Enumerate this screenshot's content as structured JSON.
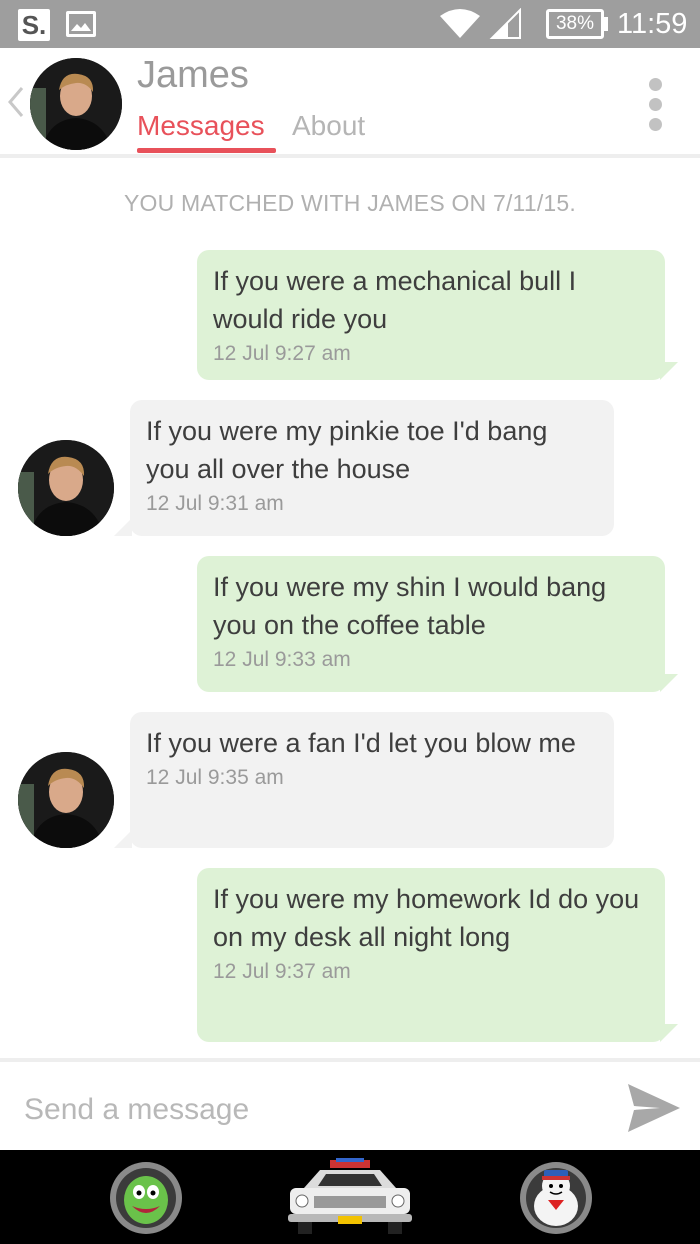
{
  "status_bar": {
    "app_icon_letter": "S.",
    "battery": "38%",
    "time": "11:59",
    "icons": [
      "app-s-icon",
      "image-icon",
      "wifi-icon",
      "signal-icon",
      "battery-icon"
    ]
  },
  "header": {
    "name": "James",
    "tabs": [
      {
        "label": "Messages",
        "active": true
      },
      {
        "label": "About",
        "active": false
      }
    ],
    "accent_color": "#e8515a"
  },
  "chat": {
    "match_notice": "YOU MATCHED WITH JAMES ON 7/11/15.",
    "messages": [
      {
        "from": "me",
        "text": "If you were a mechanical bull I would ride you",
        "time": "12 Jul 9:27 am"
      },
      {
        "from": "james",
        "text": "If you were my pinkie toe I'd bang you all over the house",
        "time": "12 Jul 9:31 am"
      },
      {
        "from": "me",
        "text": "If you were my shin I would bang you on the coffee table",
        "time": "12 Jul 9:33 am"
      },
      {
        "from": "james",
        "text": "If you were a fan I'd let you blow me",
        "time": "12 Jul 9:35 am"
      },
      {
        "from": "me",
        "text": "If you were my homework Id do you on my desk all night long",
        "time": "12 Jul 9:37 am"
      }
    ],
    "outgoing_color": "#def2d6",
    "incoming_color": "#f2f2f2"
  },
  "composer": {
    "placeholder": "Send a message",
    "send_icon": "send-icon"
  },
  "bottom_bar": {
    "icons": [
      "slimer-icon",
      "ecto-car-icon",
      "stay-puft-icon"
    ]
  }
}
